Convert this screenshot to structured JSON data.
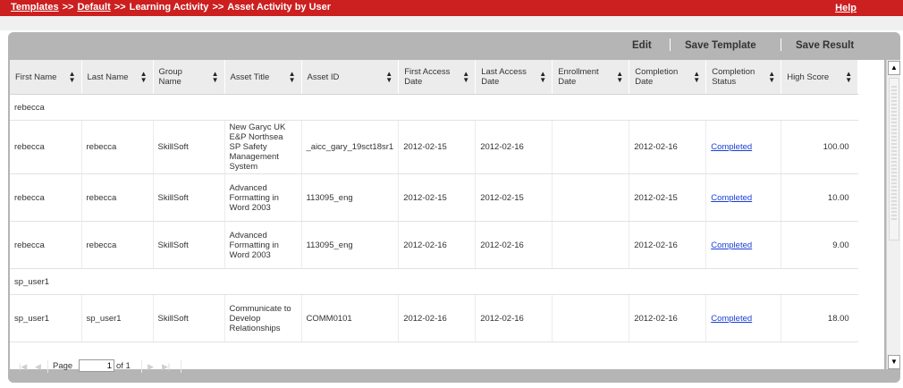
{
  "breadcrumb": {
    "items": [
      "Templates",
      "Default",
      "Learning Activity",
      "Asset Activity by User"
    ],
    "separator": ">>"
  },
  "help_label": "Help",
  "toolbar": {
    "edit": "Edit",
    "save_template": "Save Template",
    "save_result": "Save Result"
  },
  "columns": [
    "First Name",
    "Last Name",
    "Group Name",
    "Asset Title",
    "Asset ID",
    "First Access Date",
    "Last Access Date",
    "Enrollment Date",
    "Completion Date",
    "Completion Status",
    "High Score"
  ],
  "groups": [
    {
      "label": "rebecca",
      "rows": [
        [
          "rebecca",
          "rebecca",
          "SkillSoft",
          "New Garyc UK E&P Northsea SP Safety Management System",
          "_aicc_gary_19sct18sr1",
          "2012-02-15",
          "2012-02-16",
          "",
          "2012-02-16",
          "Completed",
          "100.00"
        ],
        [
          "rebecca",
          "rebecca",
          "SkillSoft",
          "Advanced Formatting in Word 2003",
          "113095_eng",
          "2012-02-15",
          "2012-02-15",
          "",
          "2012-02-15",
          "Completed",
          "10.00"
        ],
        [
          "rebecca",
          "rebecca",
          "SkillSoft",
          "Advanced Formatting in Word 2003",
          "113095_eng",
          "2012-02-16",
          "2012-02-16",
          "",
          "2012-02-16",
          "Completed",
          "9.00"
        ]
      ]
    },
    {
      "label": "sp_user1",
      "rows": [
        [
          "sp_user1",
          "sp_user1",
          "SkillSoft",
          "Communicate to Develop Relationships",
          "COMM0101",
          "2012-02-16",
          "2012-02-16",
          "",
          "2012-02-16",
          "Completed",
          "18.00"
        ]
      ]
    }
  ],
  "pager": {
    "page_label": "Page",
    "page_value": "1",
    "of_label": "of 1"
  },
  "colors": {
    "topbar": "#cc1f1f",
    "panel": "#b5b5b5",
    "link": "#1a3fd6"
  }
}
